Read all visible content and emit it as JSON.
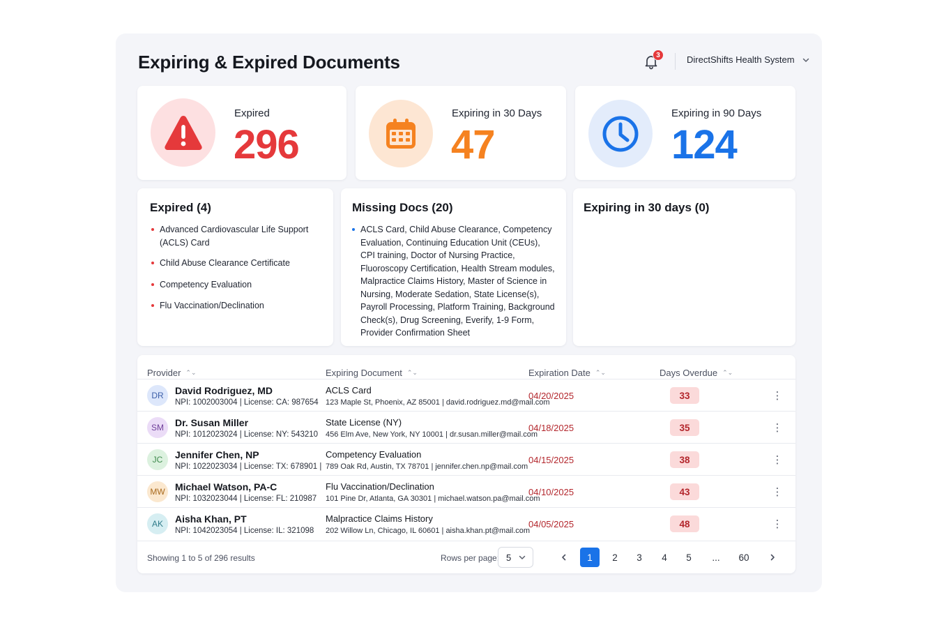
{
  "header": {
    "title": "Expiring & Expired Documents",
    "notification_count": "3",
    "org_name": "DirectShifts Health System"
  },
  "stats": [
    {
      "label": "Expired",
      "value": "296",
      "icon": "warning-triangle-icon",
      "color": "#e5393b",
      "bg": "#fde0e1"
    },
    {
      "label": "Expiring in 30 Days",
      "value": "47",
      "icon": "calendar-icon",
      "color": "#f58220",
      "bg": "#fde6d3"
    },
    {
      "label": "Expiring in 90 Days",
      "value": "124",
      "icon": "clock-icon",
      "color": "#1a73e8",
      "bg": "#e3ecfb"
    }
  ],
  "lists": {
    "expired": {
      "title": "Expired (4)",
      "items": [
        "Advanced Cardiovascular Life Support (ACLS) Card",
        "Child Abuse Clearance Certificate",
        "Competency Evaluation",
        "Flu Vaccination/Declination"
      ]
    },
    "missing": {
      "title": "Missing Docs (20)",
      "items": [
        "ACLS Card, Child Abuse Clearance, Competency Evaluation, Continuing Education Unit (CEUs), CPI training, Doctor of Nursing Practice, Fluoroscopy Certification, Health Stream modules, Malpractice Claims History, Master of Science in Nursing, Moderate Sedation, State License(s), Payroll Processing, Platform Training, Background Check(s), Drug Screening, Everify, 1-9 Form, Provider Confirmation Sheet"
      ]
    },
    "expiring30": {
      "title": "Expiring in 30 days (0)",
      "items": []
    }
  },
  "table": {
    "columns": [
      "Provider",
      "Expiring Document",
      "Expiration Date",
      "Days Overdue"
    ],
    "rows": [
      {
        "initials": "DR",
        "name": "David Rodriguez, MD",
        "meta": "NPI: 1002003004  |  License: CA: 987654",
        "document": "ACLS Card",
        "address": "123 Maple St, Phoenix, AZ 85001 | david.rodriguez.md@mail.com",
        "date": "04/20/2025",
        "overdue": "33",
        "avatar_bg": "#dde7fb",
        "avatar_fg": "#3d5fa8"
      },
      {
        "initials": "SM",
        "name": "Dr. Susan Miller",
        "meta": "NPI: 1012023024  |  License: NY: 543210",
        "document": "State License (NY)",
        "address": "456 Elm Ave, New York, NY 10001 | dr.susan.miller@mail.com",
        "date": "04/18/2025",
        "overdue": "35",
        "avatar_bg": "#ebdcf7",
        "avatar_fg": "#6f3f9a"
      },
      {
        "initials": "JC",
        "name": "Jennifer Chen, NP",
        "meta": "NPI: 1022023034  |  License: TX: 678901  |",
        "document": "Competency Evaluation",
        "address": "789 Oak Rd, Austin, TX 78701 | jennifer.chen.np@mail.com",
        "date": "04/15/2025",
        "overdue": "38",
        "avatar_bg": "#dcf1df",
        "avatar_fg": "#3f8a4d"
      },
      {
        "initials": "MW",
        "name": "Michael Watson, PA-C",
        "meta": "NPI: 1032023044  |  License: FL: 210987",
        "document": "Flu Vaccination/Declination",
        "address": "101 Pine Dr, Atlanta, GA 30301 | michael.watson.pa@mail.com",
        "date": "04/10/2025",
        "overdue": "43",
        "avatar_bg": "#fbe8cf",
        "avatar_fg": "#a86a1e"
      },
      {
        "initials": "AK",
        "name": "Aisha Khan, PT",
        "meta": "NPI: 1042023054  |  License: IL: 321098",
        "document": "Malpractice Claims History",
        "address": "202 Willow Ln, Chicago, IL 60601 | aisha.khan.pt@mail.com",
        "date": "04/05/2025",
        "overdue": "48",
        "avatar_bg": "#d6eef2",
        "avatar_fg": "#2f7c8a"
      }
    ]
  },
  "pagination": {
    "showing": "Showing 1 to 5 of 296 results",
    "rows_label": "Rows per page:",
    "rows_value": "5",
    "pages": [
      "1",
      "2",
      "3",
      "4",
      "5",
      "...",
      "60"
    ],
    "current": "1"
  }
}
